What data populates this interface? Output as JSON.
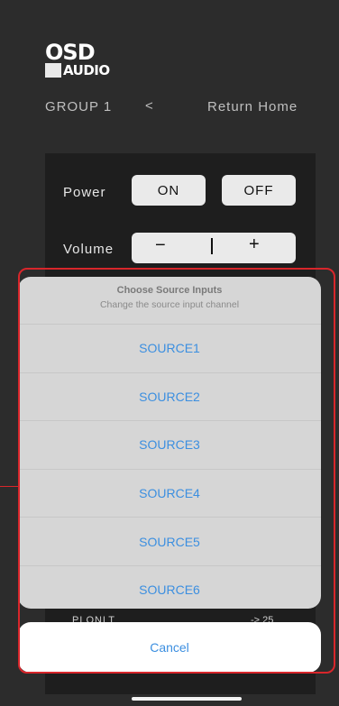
{
  "header": {
    "logo_top": "OSD",
    "logo_bottom": "AUDIO",
    "group": "GROUP 1",
    "back_glyph": "<",
    "return_home": "Return Home"
  },
  "controls": {
    "power_label": "Power",
    "on": "ON",
    "off": "OFF",
    "volume_label": "Volume",
    "volume_minus": "−",
    "volume_plus": "+"
  },
  "background_fragments": {
    "left": "PLONLT",
    "right": "->  25"
  },
  "action_sheet": {
    "title": "Choose Source Inputs",
    "subtitle": "Change the source input channel",
    "options": [
      "SOURCE1",
      "SOURCE2",
      "SOURCE3",
      "SOURCE4",
      "SOURCE5",
      "SOURCE6"
    ],
    "cancel": "Cancel"
  },
  "colors": {
    "accent": "#3c8fe0",
    "highlight": "#d8262b",
    "background": "#2c2c2c"
  }
}
